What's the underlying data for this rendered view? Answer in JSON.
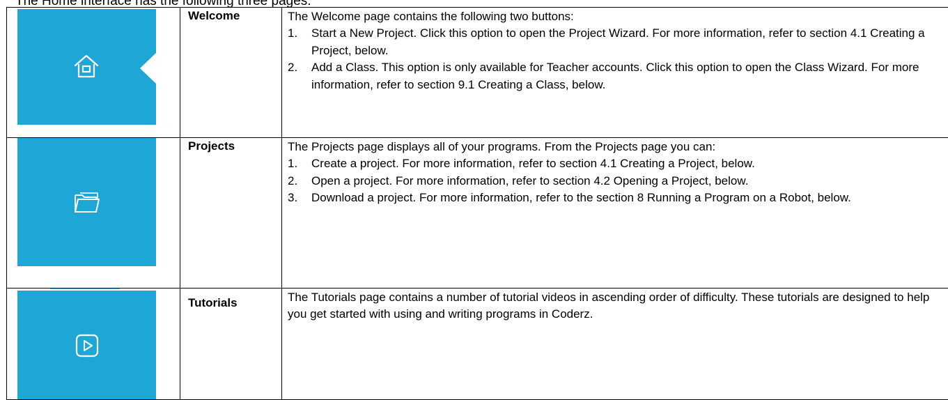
{
  "intro_text": "The Home interface has the following three pages:",
  "accent_color": "#1ea7d6",
  "rows": [
    {
      "icon": "home-icon",
      "name": "Welcome",
      "summary": "The Welcome page contains the following two buttons:",
      "items": [
        "Start a New Project. Click this option to open the Project Wizard. For more information, refer to section 4.1 Creating a Project, below.",
        "Add a Class. This option is only available for Teacher accounts. Click this option to open the Class Wizard. For more information, refer to section 9.1 Creating a Class, below."
      ]
    },
    {
      "icon": "folder-icon",
      "name": "Projects",
      "summary": "The Projects page displays all of your programs. From the Projects page you can:",
      "items": [
        "Create a project. For more information, refer to section 4.1 Creating a Project, below.",
        "Open a project. For more information, refer to section 4.2 Opening a Project, below.",
        "Download a project. For more information, refer to the section 8 Running a Program on a Robot, below."
      ]
    },
    {
      "icon": "play-icon",
      "name": "Tutorials",
      "summary": "The Tutorials page contains a number of tutorial videos in ascending order of difficulty. These tutorials are designed to help you get started with using and writing programs in Coderz."
    }
  ],
  "list_numbers": [
    "1.",
    "2.",
    "3."
  ]
}
